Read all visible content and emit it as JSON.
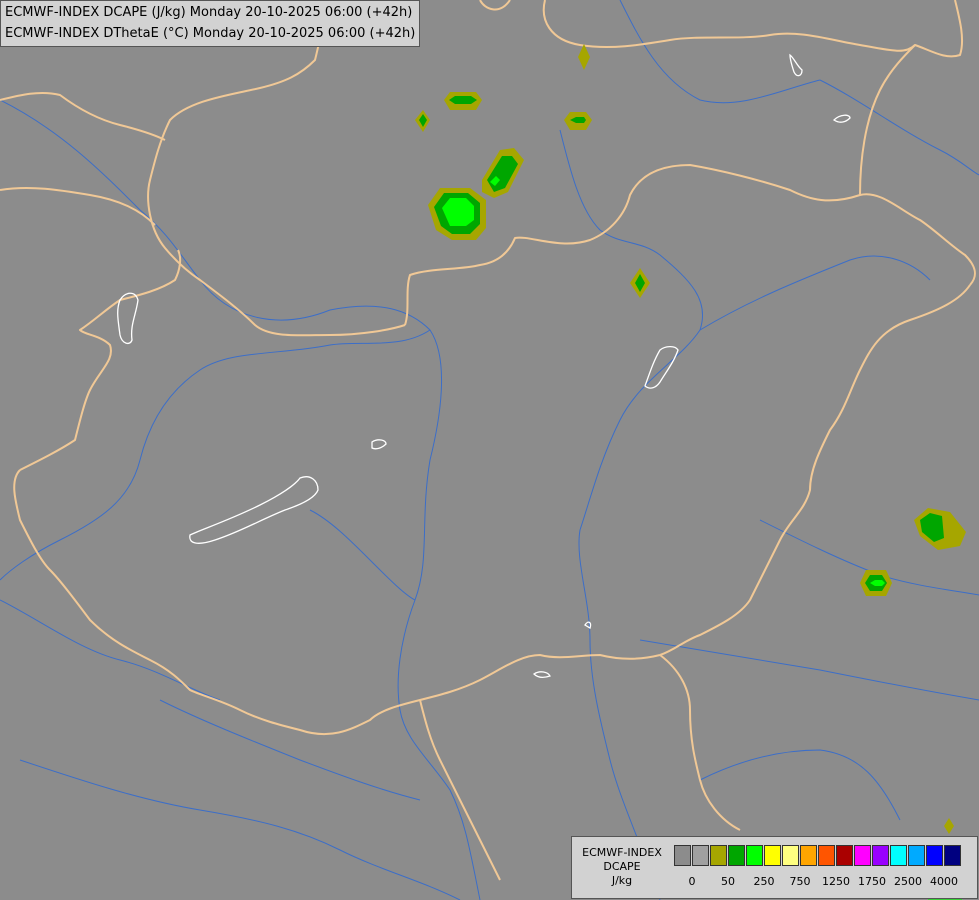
{
  "header": {
    "line1": "ECMWF-INDEX DCAPE (J/kg) Monday 20-10-2025 06:00 (+42h)",
    "line2": "ECMWF-INDEX DThetaE (°C) Monday 20-10-2025 06:00 (+42h)"
  },
  "legend": {
    "line1": "ECMWF-INDEX",
    "line2": "DCAPE",
    "line3": "J/kg",
    "colors": [
      "#8c8c8c",
      "#a0a0a0",
      "#a6a600",
      "#00a600",
      "#00ff00",
      "#ffff00",
      "#ffff80",
      "#ffa500",
      "#ff5500",
      "#aa0000",
      "#ff00ff",
      "#9900ff",
      "#00ffff",
      "#00aaff",
      "#0000ff",
      "#000080"
    ],
    "ticks": [
      "0",
      "50",
      "250",
      "750",
      "1250",
      "1750",
      "2500",
      "4000"
    ]
  },
  "colors": {
    "background": "#8c8c8c",
    "borders": "#f0c896",
    "rivers": "#3c6ec8",
    "lakes": "#ffffff"
  }
}
